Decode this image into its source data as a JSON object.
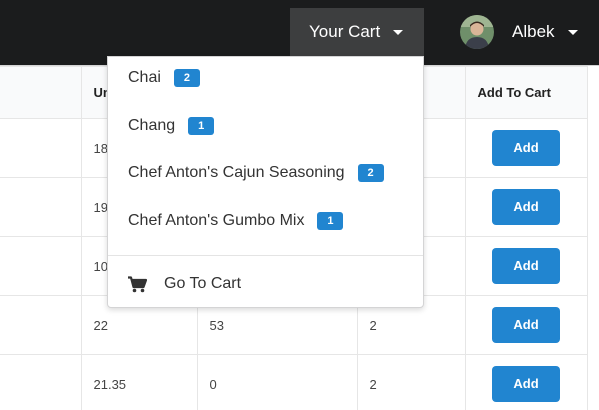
{
  "header": {
    "cart_label": "Your Cart",
    "user_name": "Albek"
  },
  "table": {
    "headers": [
      "",
      "Un",
      "",
      "",
      "Add To Cart"
    ],
    "rows": [
      {
        "c1": "",
        "c2": "18",
        "c3": "",
        "c4": "",
        "action": "Add"
      },
      {
        "c1": "",
        "c2": "19",
        "c3": "",
        "c4": "",
        "action": "Add"
      },
      {
        "c1": "",
        "c2": "10",
        "c3": "",
        "c4": "",
        "action": "Add"
      },
      {
        "c1": "",
        "c2": "22",
        "c3": "53",
        "c4": "2",
        "action": "Add"
      },
      {
        "c1": "",
        "c2": "21.35",
        "c3": "0",
        "c4": "2",
        "action": "Add"
      }
    ]
  },
  "cart_menu": {
    "items": [
      {
        "name": "Chai",
        "qty": "2"
      },
      {
        "name": "Chang",
        "qty": "1"
      },
      {
        "name": "Chef Anton's Cajun Seasoning",
        "qty": "2"
      },
      {
        "name": "Chef Anton's Gumbo Mix",
        "qty": "1"
      }
    ],
    "go_to_cart_label": "Go To Cart",
    "go_to_cart_icon": "shopping-cart-icon"
  },
  "colors": {
    "topbar": "#1b1c1d",
    "cart_trigger": "#3d3e3f",
    "primary_blue": "#2185d0"
  }
}
